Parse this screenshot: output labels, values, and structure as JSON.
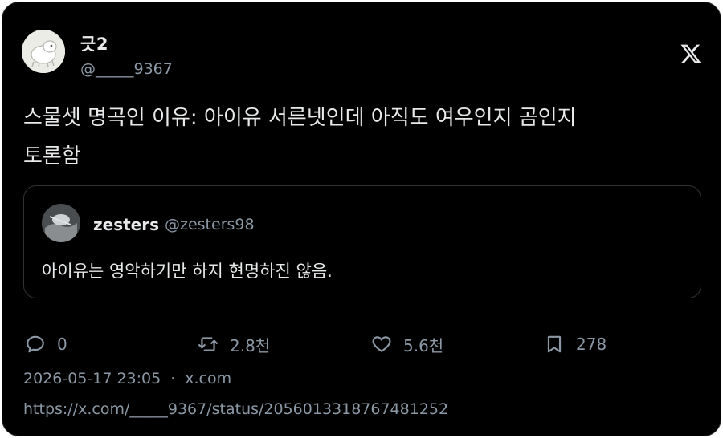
{
  "author": {
    "display_name": "긋2",
    "handle": "@_____9367"
  },
  "tweet": {
    "text": "스물셋 명곡인 이유: 아이유 서른넷인데 아직도 여우인지 곰인지\n토론함"
  },
  "quoted_tweet": {
    "display_name": "zesters",
    "handle": "@zesters98",
    "text": "아이유는 영악하기만 하지 현명하진 않음."
  },
  "actions": {
    "reply_count": "0",
    "retweet_count": "2.8천",
    "like_count": "5.6천",
    "bookmark_count": "278"
  },
  "meta": {
    "timestamp": "2026-05-17 23:05",
    "separator": "·",
    "source": "x.com",
    "url": "https://x.com/_____9367/status/2056013318767481252"
  },
  "icons": {
    "platform": "x-logo-icon",
    "reply": "reply-icon",
    "retweet": "retweet-icon",
    "like": "heart-icon",
    "bookmark": "bookmark-icon"
  },
  "colors": {
    "background": "#000000",
    "text_primary": "#e7e9ea",
    "text_secondary": "#8b98a5",
    "border": "#2f3336"
  }
}
